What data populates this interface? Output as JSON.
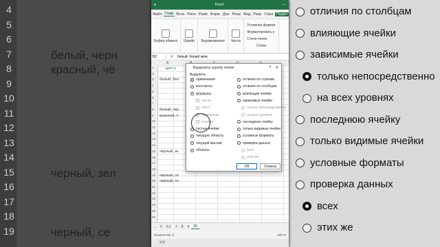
{
  "background": {
    "row_numbers": [
      "4",
      "5",
      "6",
      "7",
      "8",
      "9",
      "10",
      "11",
      "12",
      "13",
      "14",
      "15",
      "16",
      "17",
      "18",
      "19"
    ],
    "left_text": [
      {
        "text": "белый, черн",
        "row": 3
      },
      {
        "text": "красный, чё",
        "row": 4
      },
      {
        "text": "черный, зел",
        "row": 11
      },
      {
        "text": "черный, се",
        "row": 15
      }
    ],
    "right_options": [
      {
        "label": "отличия по столбцам",
        "type": "radio",
        "selected": false
      },
      {
        "label": "влияющие ячейки",
        "type": "radio",
        "selected": false
      },
      {
        "label": "зависимые ячейки",
        "type": "radio",
        "selected": false
      },
      {
        "label": "только непосредственно",
        "type": "radio",
        "selected": true,
        "indent": true
      },
      {
        "label": "на всех уровнях",
        "type": "radio",
        "selected": false,
        "indent": true
      },
      {
        "label": "последнюю ячейку",
        "type": "radio",
        "selected": false
      },
      {
        "label": "только видимые ячейки",
        "type": "radio",
        "selected": false
      },
      {
        "label": "условные форматы",
        "type": "radio",
        "selected": false
      },
      {
        "label": "проверка данных",
        "type": "radio",
        "selected": false
      },
      {
        "label": "всех",
        "type": "radio",
        "selected": true,
        "indent": true
      },
      {
        "label": "этих же",
        "type": "radio",
        "selected": false,
        "indent": true
      }
    ]
  },
  "window": {
    "title": "Excel",
    "tabs": [
      "Файл",
      "Глав",
      "Вста",
      "Рисо",
      "Разм",
      "Форм",
      "Дан",
      "Реце",
      "Вид",
      "Разр",
      "Спра"
    ],
    "share_label": "Подел"
  },
  "ribbon": {
    "clipboard": "Буфер обмена",
    "font": "Шрифт",
    "alignment": "Выравнивание",
    "number": "Число",
    "styles": [
      "Условное формат",
      "Форматировать к",
      "Стили ячеек"
    ],
    "styles_group": "Стили"
  },
  "formula_bar": {
    "name_box": "B2",
    "fx": "fx",
    "value": "белый, белый зеле"
  },
  "grid": {
    "columns": [
      "A",
      "B",
      "C",
      "D",
      "E"
    ],
    "header_cell": "цвет о",
    "cells": [
      {
        "text": "белый, бел",
        "row": 2
      },
      {
        "text": "белый, чер",
        "row": 7
      },
      {
        "text": "красный, ч",
        "row": 8
      },
      {
        "text": "черный, зе",
        "row": 14
      },
      {
        "text": "черный, се",
        "row": 18
      },
      {
        "text": "черный, се",
        "row": 19
      }
    ]
  },
  "dialog": {
    "title": "Выделить группу ячеек",
    "help": "?",
    "close": "✕",
    "section": "Выделить",
    "left_options": [
      {
        "label": "примечания",
        "kind": "radio",
        "selected": true
      },
      {
        "label": "константы",
        "kind": "radio"
      },
      {
        "label": "формулы",
        "kind": "radio"
      },
      {
        "label": "числа",
        "kind": "check",
        "disabled": true
      },
      {
        "label": "текст",
        "kind": "check",
        "disabled": true
      },
      {
        "label": "логические",
        "kind": "check",
        "disabled": true
      },
      {
        "label": "ошибки",
        "kind": "check",
        "disabled": true
      },
      {
        "label": "пустые ячейки",
        "kind": "radio"
      },
      {
        "label": "текущую область",
        "kind": "radio"
      },
      {
        "label": "текущий массив",
        "kind": "radio"
      },
      {
        "label": "объекты",
        "kind": "radio"
      }
    ],
    "right_options": [
      {
        "label": "отличия по строкам",
        "kind": "radio"
      },
      {
        "label": "отличия по столбцам",
        "kind": "radio"
      },
      {
        "label": "влияющие ячейки",
        "kind": "radio"
      },
      {
        "label": "зависимые ячейки",
        "kind": "radio"
      },
      {
        "label": "только непосредственно",
        "kind": "radio",
        "disabled": true
      },
      {
        "label": "на всех уровнях",
        "kind": "radio",
        "disabled": true
      },
      {
        "label": "последнюю ячейку",
        "kind": "radio"
      },
      {
        "label": "только видимые ячейки",
        "kind": "radio"
      },
      {
        "label": "условные форматы",
        "kind": "radio"
      },
      {
        "label": "проверка данных",
        "kind": "radio"
      },
      {
        "label": "всех",
        "kind": "radio",
        "disabled": true
      },
      {
        "label": "этих же",
        "kind": "radio",
        "disabled": true
      }
    ],
    "ok": "ОК",
    "cancel": "Отмена"
  },
  "sheets": [
    "...",
    "5",
    "6.1",
    "7",
    "8",
    "9",
    "10"
  ],
  "active_sheet": "10",
  "status": {
    "count": "Количество: 9",
    "zoom": "100 %"
  },
  "taskbar": {
    "temp": "2°C"
  }
}
